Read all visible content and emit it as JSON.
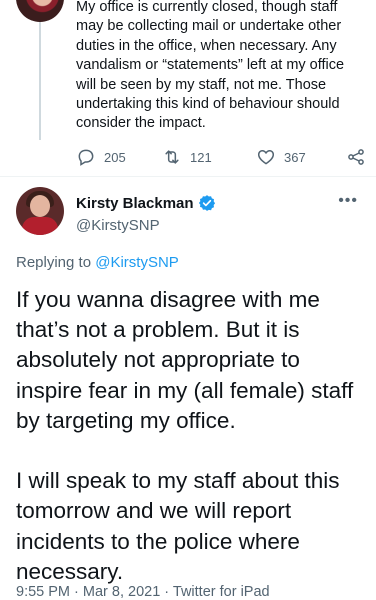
{
  "previous_tweet": {
    "text": "My office is currently closed, though staff may be collecting mail or undertake other duties in the office, when necessary. Any vandalism or “statements” left at my office will be seen by my staff, not me. Those undertaking this kind of behaviour should consider the impact.",
    "replies": "205",
    "retweets": "121",
    "likes": "367"
  },
  "tweet": {
    "author_name": "Kirsty Blackman",
    "author_handle": "@KirstySNP",
    "replying_label": "Replying to ",
    "replying_to": "@KirstySNP",
    "text": "If you wanna disagree with me that’s not a problem. But it is absolutely not appropriate to inspire fear in my (all female) staff by targeting my office.\n\nI will speak to my staff about this tomorrow and we will report incidents to the police where necessary.",
    "timestamp": "9:55 PM · Mar 8, 2021 · Twitter for iPad"
  },
  "icons": {
    "reply": "reply-icon",
    "retweet": "retweet-icon",
    "like": "heart-icon",
    "share": "share-icon",
    "verified": "verified-badge-icon",
    "more": "more-icon"
  },
  "colors": {
    "accent": "#1d9bf0",
    "secondary_text": "#536471"
  }
}
